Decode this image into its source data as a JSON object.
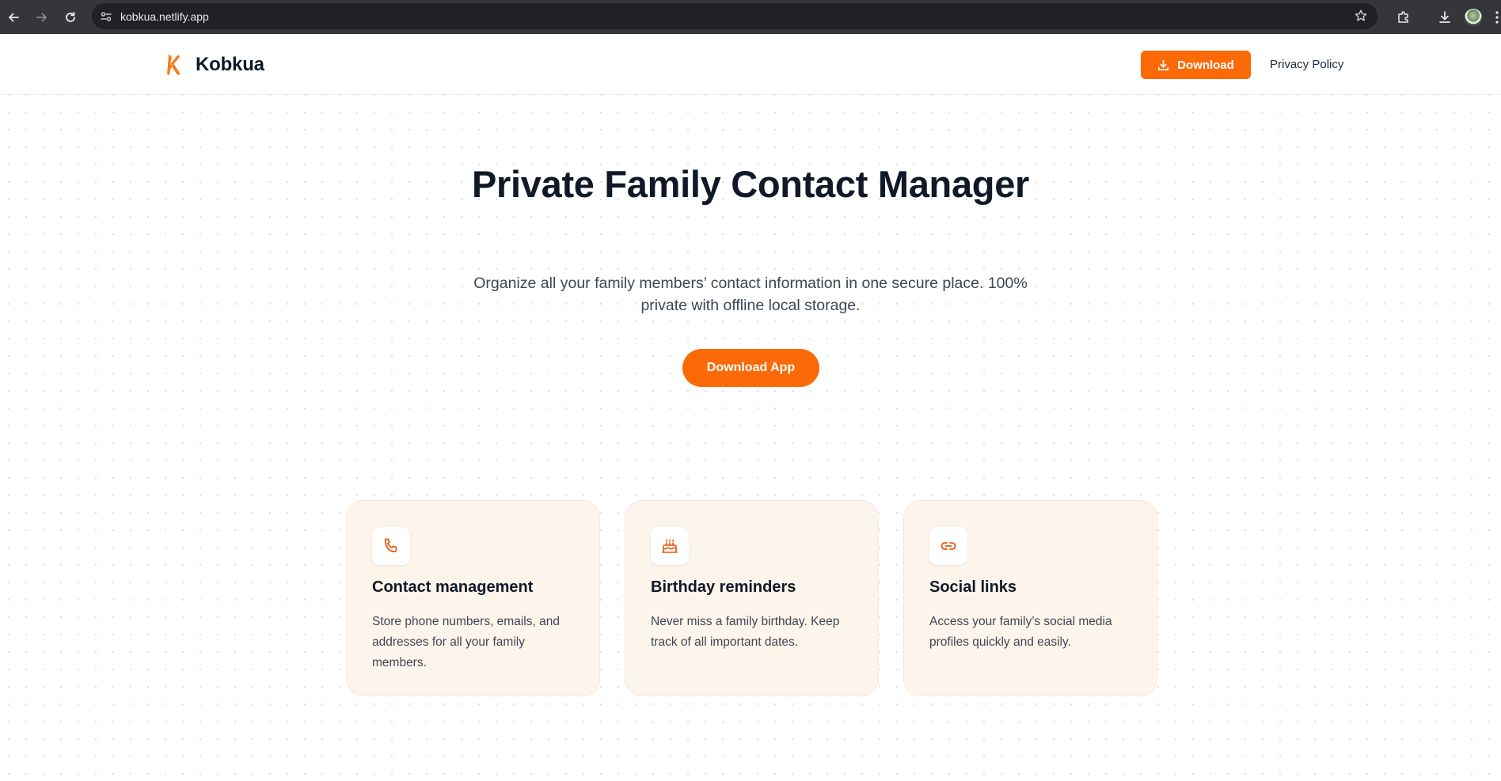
{
  "browser": {
    "url": "kobkua.netlify.app",
    "icons": [
      "back-arrow-icon",
      "forward-arrow-icon",
      "reload-icon",
      "site-info-icon",
      "bookmark-star-icon",
      "extensions-icon",
      "downloads-icon",
      "profile-avatar-icon",
      "menu-dots-icon"
    ]
  },
  "header": {
    "brand_name": "Kobkua",
    "download_label": "Download",
    "privacy_label": "Privacy Policy"
  },
  "hero": {
    "title": "Private Family Contact Manager",
    "subtitle": "Organize all your family members’ contact information in one secure place. 100% private with offline local storage.",
    "cta_label": "Download App"
  },
  "features": [
    {
      "icon": "phone-icon",
      "title": "Contact management",
      "description": "Store phone numbers, emails, and addresses for all your family members."
    },
    {
      "icon": "cake-icon",
      "title": "Birthday reminders",
      "description": "Never miss a family birthday. Keep track of all important dates."
    },
    {
      "icon": "link-icon",
      "title": "Social links",
      "description": "Access your family’s social media profiles quickly and easily."
    }
  ],
  "colors": {
    "accent": "#fb6a07",
    "card_background": "#fdf5ec",
    "icon_color": "#e8540a",
    "title_text": "#111827",
    "body_text": "#3f4652"
  }
}
